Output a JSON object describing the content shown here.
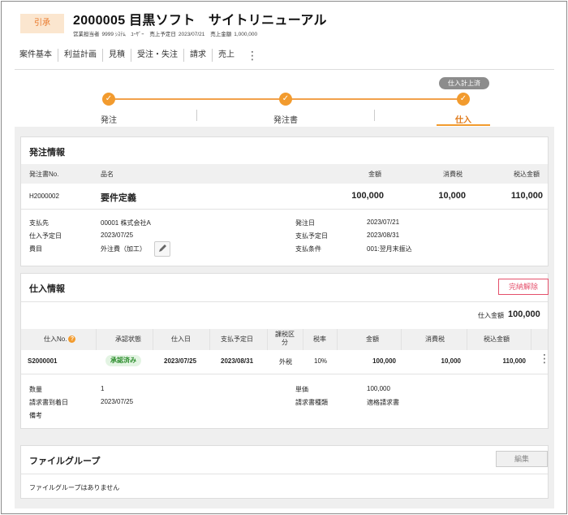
{
  "header": {
    "status_badge": "引承",
    "title": "2000005 目黒ソフト　サイトリニューアル",
    "meta": {
      "sales_rep_label": "営業担当者",
      "sales_rep_value": "9999 ｼｽﾃﾑ　ﾕｰｻﾞｰ",
      "sales_date_label": "売上予定日",
      "sales_date_value": "2023/07/21",
      "sales_amount_label": "売上金額",
      "sales_amount_value": "1,000,000"
    }
  },
  "tabs": [
    "案件基本",
    "利益計画",
    "見積",
    "受注・失注",
    "請求",
    "売上"
  ],
  "flow": {
    "badge": "仕入計上済",
    "steps": [
      "発注",
      "発注書",
      "仕入"
    ],
    "check_glyph": "✓"
  },
  "order": {
    "title": "発注情報",
    "headers": {
      "no": "発注書No.",
      "item": "品名",
      "amount": "金額",
      "tax": "消費税",
      "total": "税込金額"
    },
    "row": {
      "no": "H2000002",
      "item": "要件定義",
      "amount": "100,000",
      "tax": "10,000",
      "total": "110,000"
    },
    "details_left": [
      {
        "label": "支払先",
        "value": "00001  株式会社A"
      },
      {
        "label": "仕入予定日",
        "value": "2023/07/25"
      },
      {
        "label": "費目",
        "value": "外注費（加工）"
      }
    ],
    "details_right": [
      {
        "label": "発注日",
        "value": "2023/07/21"
      },
      {
        "label": "支払予定日",
        "value": "2023/08/31"
      },
      {
        "label": "支払条件",
        "value": "001:翌月末振込"
      }
    ],
    "pencil_icon": "pencil-icon"
  },
  "purchase": {
    "title": "仕入情報",
    "release_button": "完納解除",
    "total_label": "仕入金額",
    "total_value": "100,000",
    "headers": {
      "no": "仕入No.",
      "help": "?",
      "status": "承認状態",
      "date": "仕入日",
      "pay_date": "支払予定日",
      "tax_cat": "課税区分",
      "tax_rate": "税率",
      "amount": "金額",
      "tax": "消費税",
      "total": "税込金額"
    },
    "row": {
      "no": "S2000001",
      "status": "承認済み",
      "date": "2023/07/25",
      "pay_date": "2023/08/31",
      "tax_cat": "外税",
      "tax_rate": "10%",
      "amount": "100,000",
      "tax": "10,000",
      "total": "110,000",
      "menu": "⋮"
    },
    "details_left": [
      {
        "label": "数量",
        "value": "1"
      },
      {
        "label": "請求書到着日",
        "value": "2023/07/25"
      },
      {
        "label": "備考",
        "value": ""
      }
    ],
    "details_right": [
      {
        "label": "単価",
        "value": "100,000"
      },
      {
        "label": "請求書種類",
        "value": "適格請求書"
      }
    ]
  },
  "files": {
    "title": "ファイルグループ",
    "edit_button": "編集",
    "empty_text": "ファイルグループはありません"
  },
  "colors": {
    "accent": "#f29b2e",
    "danger": "#e4506b",
    "success": "#2f8f2f"
  }
}
